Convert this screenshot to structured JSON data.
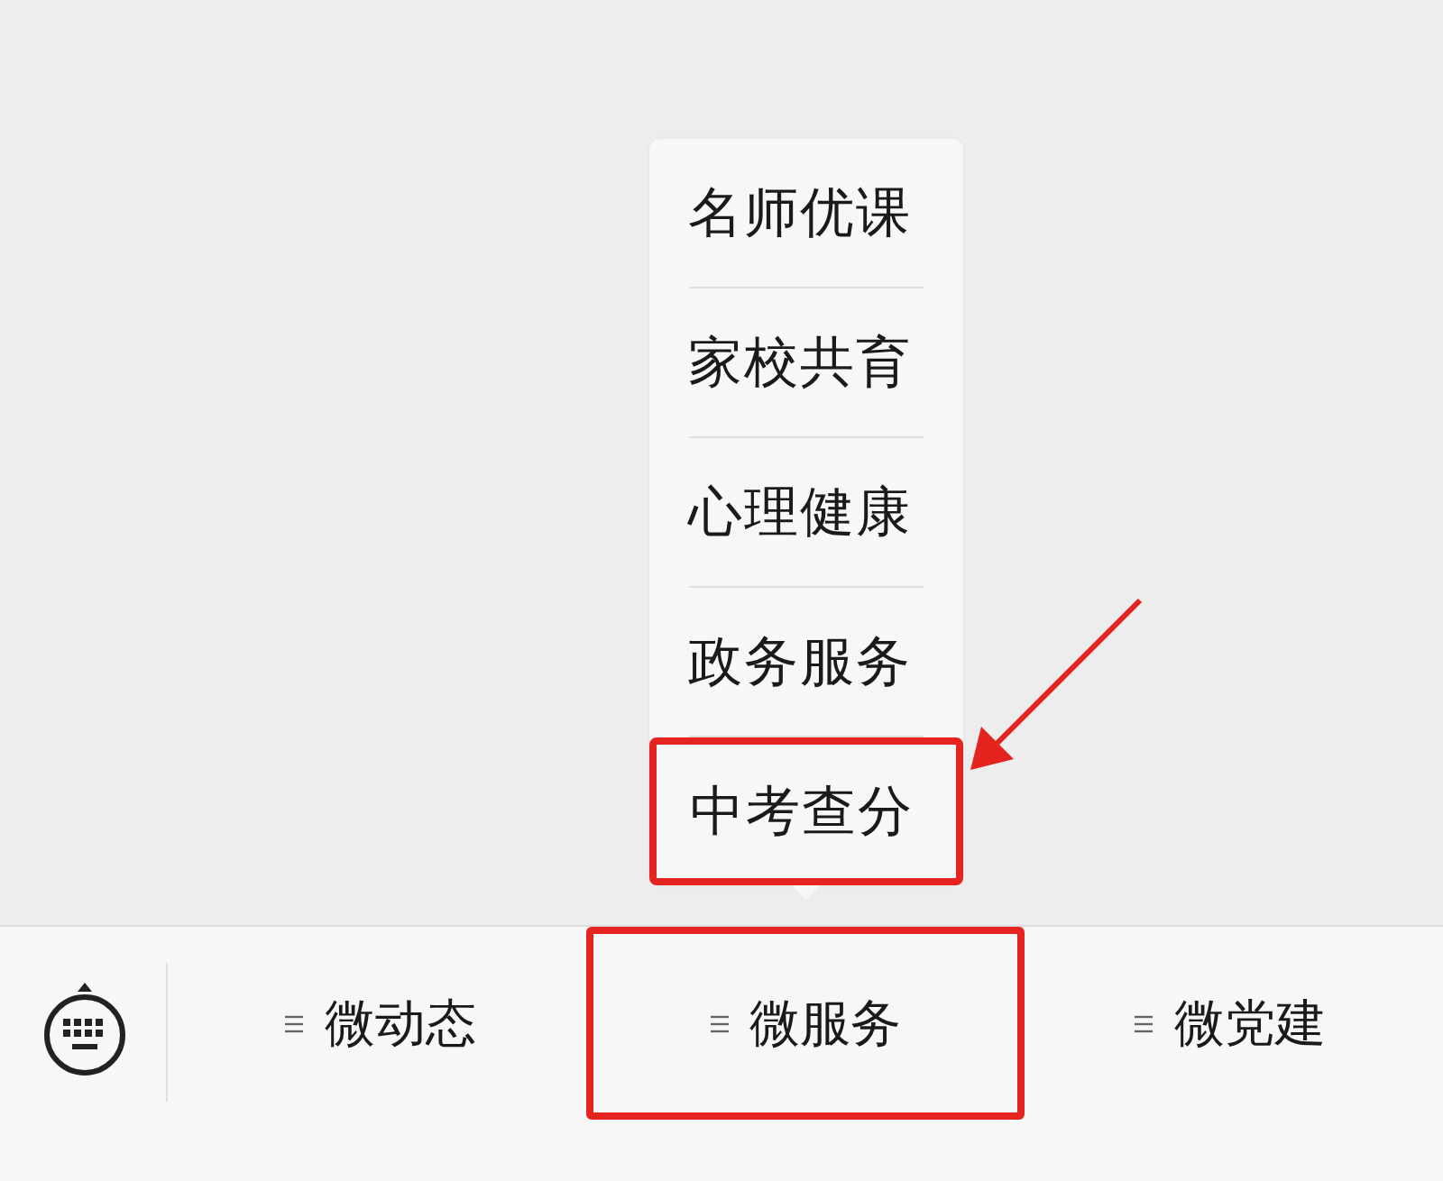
{
  "menu": {
    "tabs": [
      {
        "label": "微动态",
        "highlighted": false
      },
      {
        "label": "微服务",
        "highlighted": true,
        "items": [
          {
            "label": "名师优课",
            "highlighted": false
          },
          {
            "label": "家校共育",
            "highlighted": false
          },
          {
            "label": "心理健康",
            "highlighted": false
          },
          {
            "label": "政务服务",
            "highlighted": false
          },
          {
            "label": "中考查分",
            "highlighted": true
          }
        ]
      },
      {
        "label": "微党建",
        "highlighted": false
      }
    ]
  }
}
